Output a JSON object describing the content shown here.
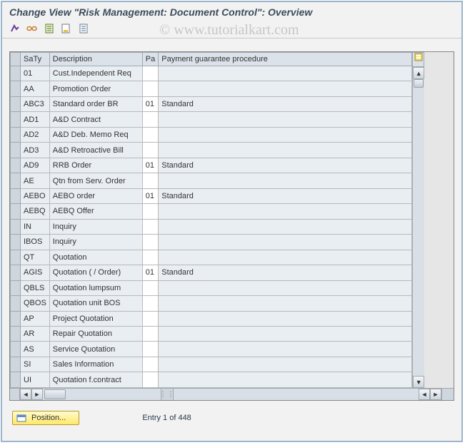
{
  "title": "Change View \"Risk Management: Document Control\": Overview",
  "watermark": "© www.tutorialkart.com",
  "toolbar": {
    "btn1": "other-view-icon",
    "btn2": "glasses-icon",
    "btn3": "new-entries-icon",
    "btn4": "delimit-icon",
    "btn5": "select-all-icon"
  },
  "columns": {
    "selector": "",
    "saty": "SaTy",
    "desc": "Description",
    "pa": "Pa",
    "pgp": "Payment guarantee procedure",
    "settings": ""
  },
  "rows": [
    {
      "saty": "01",
      "desc": "Cust.Independent Req",
      "pa": "",
      "pgp": ""
    },
    {
      "saty": "AA",
      "desc": "Promotion Order",
      "pa": "",
      "pgp": ""
    },
    {
      "saty": "ABC3",
      "desc": "Standard order BR",
      "pa": "01",
      "pgp": "Standard"
    },
    {
      "saty": "AD1",
      "desc": "A&D Contract",
      "pa": "",
      "pgp": ""
    },
    {
      "saty": "AD2",
      "desc": "A&D Deb. Memo Req",
      "pa": "",
      "pgp": ""
    },
    {
      "saty": "AD3",
      "desc": "A&D Retroactive Bill",
      "pa": "",
      "pgp": ""
    },
    {
      "saty": "AD9",
      "desc": "RRB Order",
      "pa": "01",
      "pgp": "Standard"
    },
    {
      "saty": "AE",
      "desc": "Qtn from Serv. Order",
      "pa": "",
      "pgp": ""
    },
    {
      "saty": "AEBO",
      "desc": "AEBO order",
      "pa": "01",
      "pgp": "Standard"
    },
    {
      "saty": "AEBQ",
      "desc": "AEBQ Offer",
      "pa": "",
      "pgp": ""
    },
    {
      "saty": "IN",
      "desc": "Inquiry",
      "pa": "",
      "pgp": ""
    },
    {
      "saty": "IBOS",
      "desc": "Inquiry",
      "pa": "",
      "pgp": ""
    },
    {
      "saty": "QT",
      "desc": "Quotation",
      "pa": "",
      "pgp": ""
    },
    {
      "saty": "AGIS",
      "desc": "Quotation ( / Order)",
      "pa": "01",
      "pgp": "Standard"
    },
    {
      "saty": "QBLS",
      "desc": "Quotation lumpsum",
      "pa": "",
      "pgp": ""
    },
    {
      "saty": "QBOS",
      "desc": "Quotation unit BOS",
      "pa": "",
      "pgp": ""
    },
    {
      "saty": "AP",
      "desc": "Project Quotation",
      "pa": "",
      "pgp": ""
    },
    {
      "saty": "AR",
      "desc": "Repair Quotation",
      "pa": "",
      "pgp": ""
    },
    {
      "saty": "AS",
      "desc": "Service Quotation",
      "pa": "",
      "pgp": ""
    },
    {
      "saty": "SI",
      "desc": "Sales Information",
      "pa": "",
      "pgp": ""
    },
    {
      "saty": "UI",
      "desc": "Quotation f.contract",
      "pa": "",
      "pgp": ""
    }
  ],
  "footer": {
    "position_label": "Position...",
    "entry_text": "Entry 1 of 448"
  }
}
